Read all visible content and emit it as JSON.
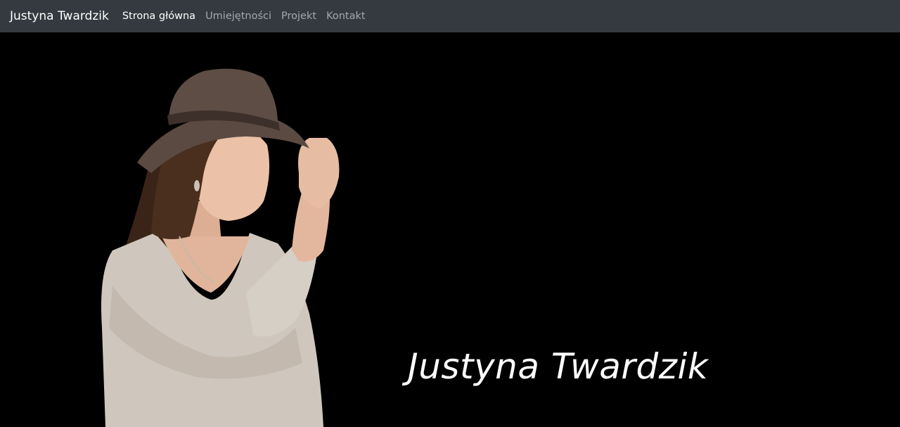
{
  "navbar": {
    "brand": "Justyna Twardzik",
    "links": [
      {
        "label": "Strona główna",
        "active": true
      },
      {
        "label": "Umiejętności",
        "active": false
      },
      {
        "label": "Projekt",
        "active": false
      },
      {
        "label": "Kontakt",
        "active": false
      }
    ]
  },
  "hero": {
    "title": "Justyna Twardzik",
    "photo_icon": "portrait-photo",
    "colors": {
      "background": "#000000",
      "navbar": "#343a40"
    }
  }
}
